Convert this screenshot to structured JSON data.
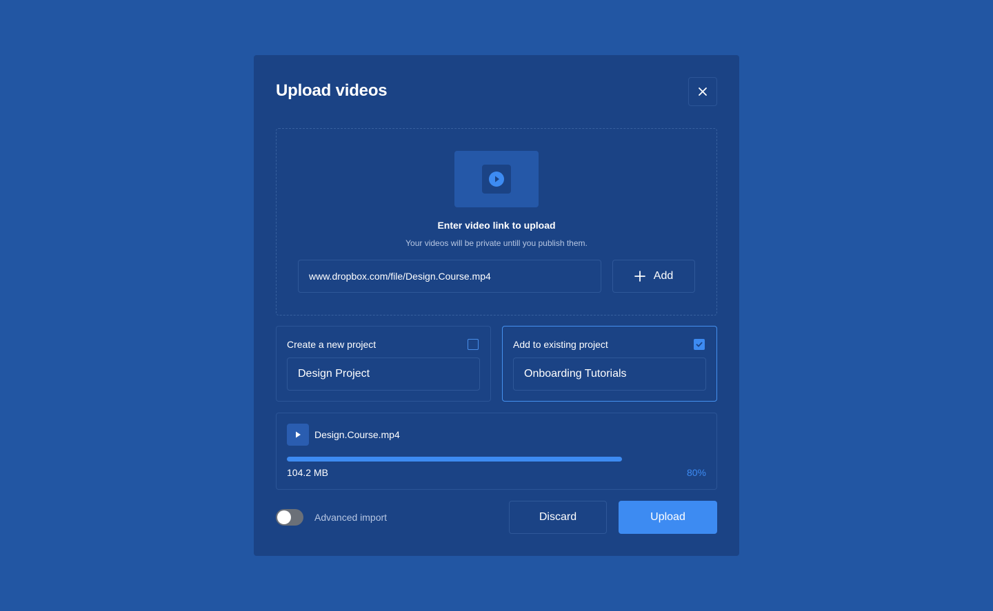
{
  "modal": {
    "title": "Upload videos"
  },
  "dropzone": {
    "title": "Enter video link to upload",
    "subtitle": "Your videos will be private untill you publish them.",
    "link_value": "www.dropbox.com/file/Design.Course.mp4",
    "add_label": "Add",
    "icon": "play-icon"
  },
  "projects": [
    {
      "label": "Create a new project",
      "value": "Design Project",
      "checked": false
    },
    {
      "label": "Add to existing project",
      "value": "Onboarding Tutorials",
      "checked": true
    }
  ],
  "file": {
    "name": "Design.Course.mp4",
    "size": "104.2 MB",
    "progress_label": "80%",
    "progress": 0.8
  },
  "footer": {
    "toggle_label": "Advanced import",
    "toggle_on": false,
    "discard_label": "Discard",
    "upload_label": "Upload"
  },
  "colors": {
    "background": "#2256a3",
    "modal": "#1b4385",
    "accent": "#3d8bf2"
  }
}
